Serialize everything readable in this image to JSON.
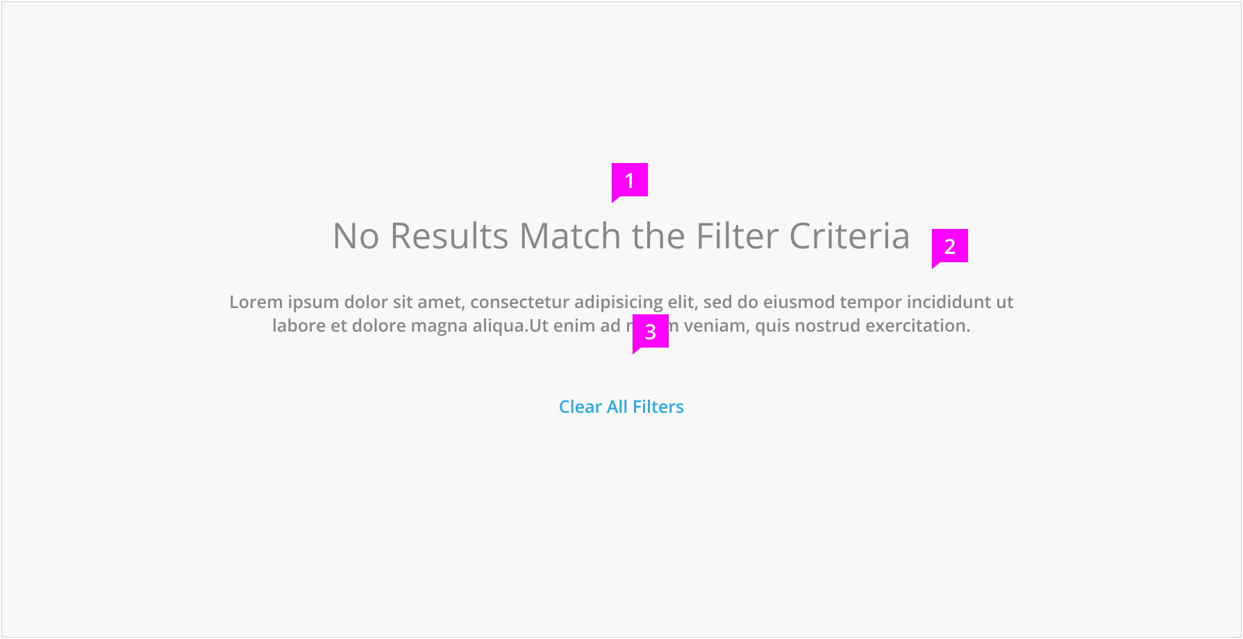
{
  "emptyState": {
    "title": "No Results Match the Filter Criteria",
    "description": "Lorem ipsum dolor sit amet, consectetur adipisicing elit, sed do eiusmod tempor incididunt ut labore et dolore magna aliqua.Ut enim ad minim veniam, quis nostrud exercitation.",
    "clearLink": "Clear All Filters"
  },
  "callouts": {
    "one": "1",
    "two": "2",
    "three": "3"
  }
}
